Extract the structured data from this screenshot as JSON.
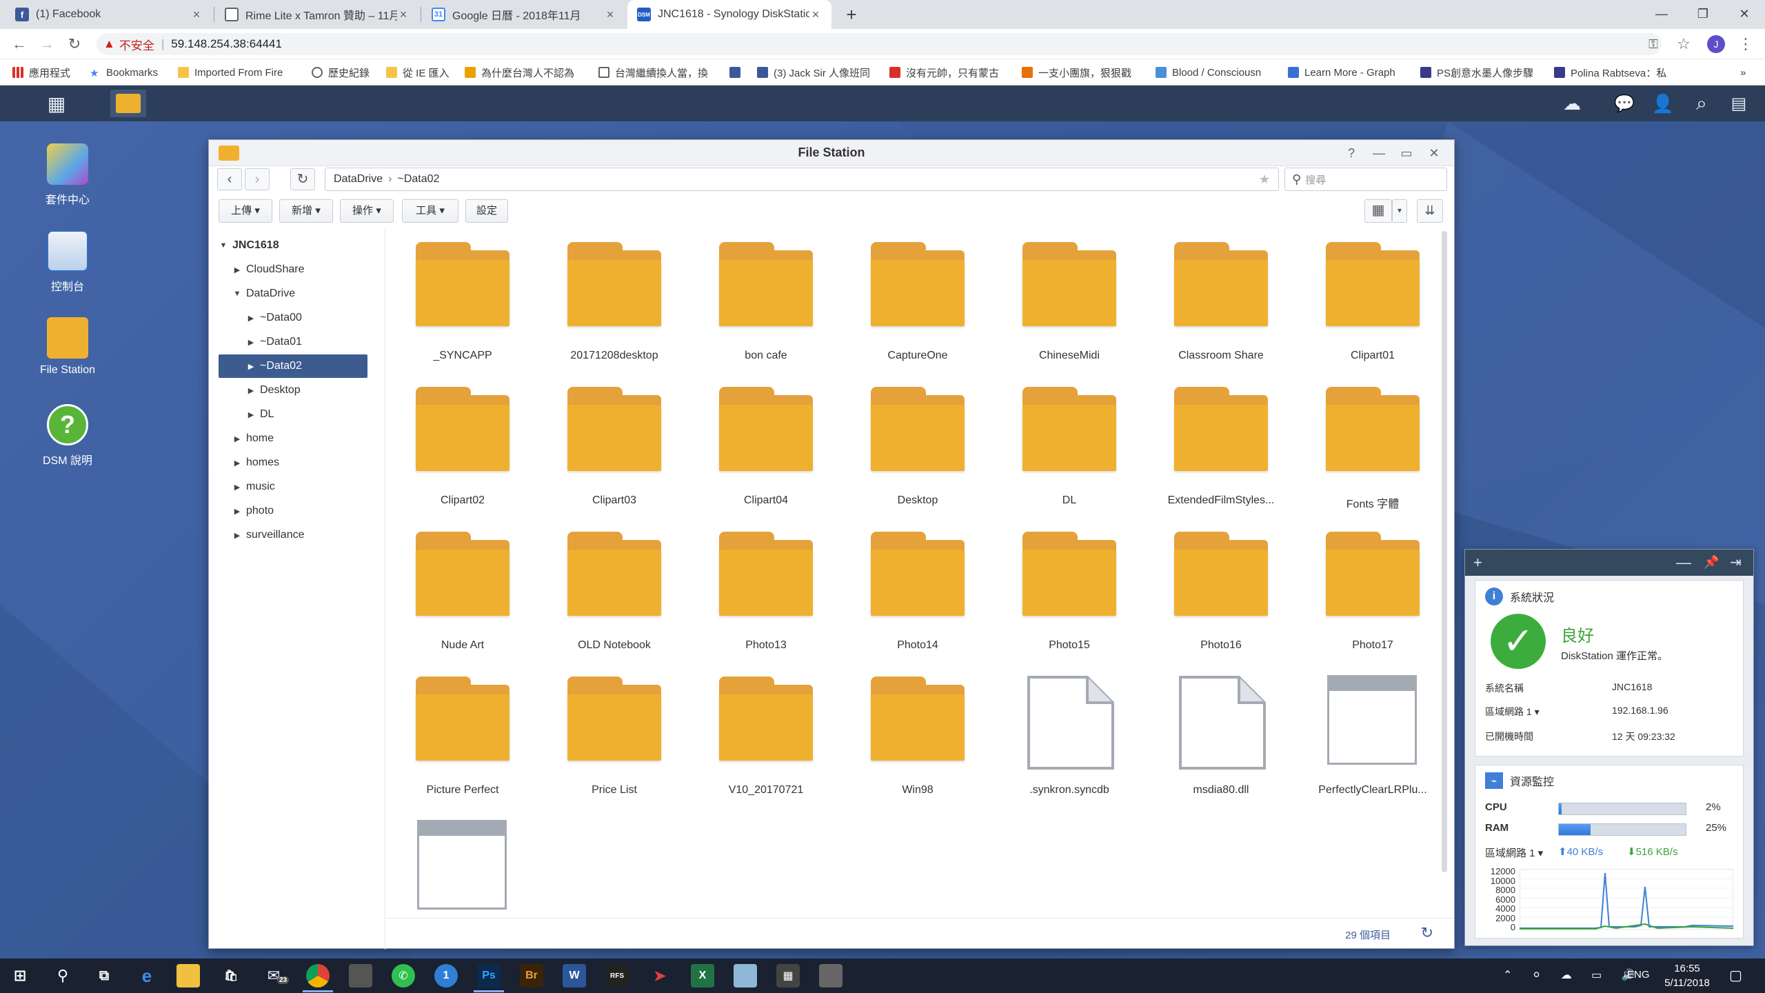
{
  "browser": {
    "tabs": [
      {
        "title": "(1) Facebook",
        "fav_color": "#3b5998",
        "fav_glyph": "f"
      },
      {
        "title": "Rime Lite x Tamron 贊助 – 11月",
        "fav_color": "#5f6368",
        "fav_glyph": ""
      },
      {
        "title": "Google 日曆 - 2018年11月",
        "fav_color": "#4285f4",
        "fav_glyph": ""
      },
      {
        "title": "JNC1618 - Synology DiskStation",
        "fav_color": "#1f5fc6",
        "fav_glyph": "DSM"
      }
    ],
    "address": {
      "insecure_label": "不安全",
      "url": "59.148.254.38:64441"
    },
    "bookmarks": [
      {
        "label": "應用程式",
        "color": "#d93025"
      },
      {
        "label": "Bookmarks",
        "color": "#4285f4"
      },
      {
        "label": "Imported From Fire",
        "color": "#f6c445"
      },
      {
        "label": "歷史紀錄",
        "color": "#5f6368"
      },
      {
        "label": "從 IE 匯入",
        "color": "#f6c445"
      },
      {
        "label": "為什麼台灣人不認為",
        "color": "#e8a200"
      },
      {
        "label": "台灣繼續換人當，換",
        "color": "#5f6368"
      },
      {
        "label": "",
        "color": "#3b5998"
      },
      {
        "label": "(3) Jack Sir 人像班同",
        "color": "#3b5998"
      },
      {
        "label": "沒有元帥，只有蒙古",
        "color": "#d93025"
      },
      {
        "label": "一支小團旗，狠狠戳",
        "color": "#e8710a"
      },
      {
        "label": "Blood / Consciousn",
        "color": "#4a90d9"
      },
      {
        "label": "Learn More - Graph",
        "color": "#3b6fd8"
      },
      {
        "label": "PS創意水墨人像步驟",
        "color": "#3a3a8a"
      },
      {
        "label": "Polina Rabtseva：私",
        "color": "#3a3a8a"
      }
    ]
  },
  "desktop": {
    "icons": [
      {
        "label": "套件中心"
      },
      {
        "label": "控制台"
      },
      {
        "label": "File Station"
      },
      {
        "label": "DSM 說明"
      }
    ]
  },
  "filestation": {
    "title": "File Station",
    "path": [
      "DataDrive",
      "~Data02"
    ],
    "search_placeholder": "搜尋",
    "toolbar": {
      "upload": "上傳",
      "create": "新增",
      "action": "操作",
      "tools": "工具",
      "settings": "設定"
    },
    "tree": [
      {
        "label": "JNC1618",
        "level": 0,
        "expanded": true,
        "bold": true
      },
      {
        "label": "CloudShare",
        "level": 1,
        "expanded": false
      },
      {
        "label": "DataDrive",
        "level": 1,
        "expanded": true
      },
      {
        "label": "~Data00",
        "level": 2,
        "expanded": false
      },
      {
        "label": "~Data01",
        "level": 2,
        "expanded": false
      },
      {
        "label": "~Data02",
        "level": 2,
        "expanded": false,
        "selected": true
      },
      {
        "label": "Desktop",
        "level": 2,
        "expanded": false
      },
      {
        "label": "DL",
        "level": 2,
        "expanded": false
      },
      {
        "label": "home",
        "level": 1,
        "expanded": false
      },
      {
        "label": "homes",
        "level": 1,
        "expanded": false
      },
      {
        "label": "music",
        "level": 1,
        "expanded": false
      },
      {
        "label": "photo",
        "level": 1,
        "expanded": false
      },
      {
        "label": "surveillance",
        "level": 1,
        "expanded": false
      }
    ],
    "items": [
      {
        "name": "_SYNCAPP",
        "type": "folder"
      },
      {
        "name": "20171208desktop",
        "type": "folder"
      },
      {
        "name": "bon cafe",
        "type": "folder"
      },
      {
        "name": "CaptureOne",
        "type": "folder"
      },
      {
        "name": "ChineseMidi",
        "type": "folder"
      },
      {
        "name": "Classroom Share",
        "type": "folder"
      },
      {
        "name": "Clipart01",
        "type": "folder"
      },
      {
        "name": "Clipart02",
        "type": "folder"
      },
      {
        "name": "Clipart03",
        "type": "folder"
      },
      {
        "name": "Clipart04",
        "type": "folder"
      },
      {
        "name": "Desktop",
        "type": "folder"
      },
      {
        "name": "DL",
        "type": "folder"
      },
      {
        "name": "ExtendedFilmStyles...",
        "type": "folder"
      },
      {
        "name": "Fonts 字體",
        "type": "folder"
      },
      {
        "name": "Nude Art",
        "type": "folder"
      },
      {
        "name": "OLD Notebook",
        "type": "folder"
      },
      {
        "name": "Photo13",
        "type": "folder"
      },
      {
        "name": "Photo14",
        "type": "folder"
      },
      {
        "name": "Photo15",
        "type": "folder"
      },
      {
        "name": "Photo16",
        "type": "folder"
      },
      {
        "name": "Photo17",
        "type": "folder"
      },
      {
        "name": "Picture Perfect",
        "type": "folder"
      },
      {
        "name": "Price List",
        "type": "folder"
      },
      {
        "name": "V10_20170721",
        "type": "folder"
      },
      {
        "name": "Win98",
        "type": "folder"
      },
      {
        "name": ".synkron.syncdb",
        "type": "file"
      },
      {
        "name": "msdia80.dll",
        "type": "file"
      },
      {
        "name": "PerfectlyClearLRPlu...",
        "type": "image"
      },
      {
        "name": "",
        "type": "image"
      }
    ],
    "item_count": "29 個項目"
  },
  "widget": {
    "health": {
      "title": "系統狀況",
      "status": "良好",
      "status_desc": "DiskStation 運作正常。",
      "rows": [
        {
          "key": "系統名稱",
          "value": "JNC1618"
        },
        {
          "key": "區域網路 1",
          "value": "192.168.1.96"
        },
        {
          "key": "已開機時間",
          "value": "12 天 09:23:32"
        }
      ]
    },
    "monitor": {
      "title": "資源監控",
      "cpu_label": "CPU",
      "cpu_pct": 2,
      "cpu_text": "2%",
      "ram_label": "RAM",
      "ram_pct": 25,
      "ram_text": "25%",
      "lan_label": "區域網路 1",
      "up": "40 KB/s",
      "down": "516 KB/s",
      "yticks": [
        "12000",
        "10000",
        "8000",
        "6000",
        "4000",
        "2000",
        "0"
      ]
    }
  },
  "taskbar": {
    "lang": "ENG",
    "time": "16:55",
    "date": "5/11/2018",
    "mail_badge": "23"
  }
}
